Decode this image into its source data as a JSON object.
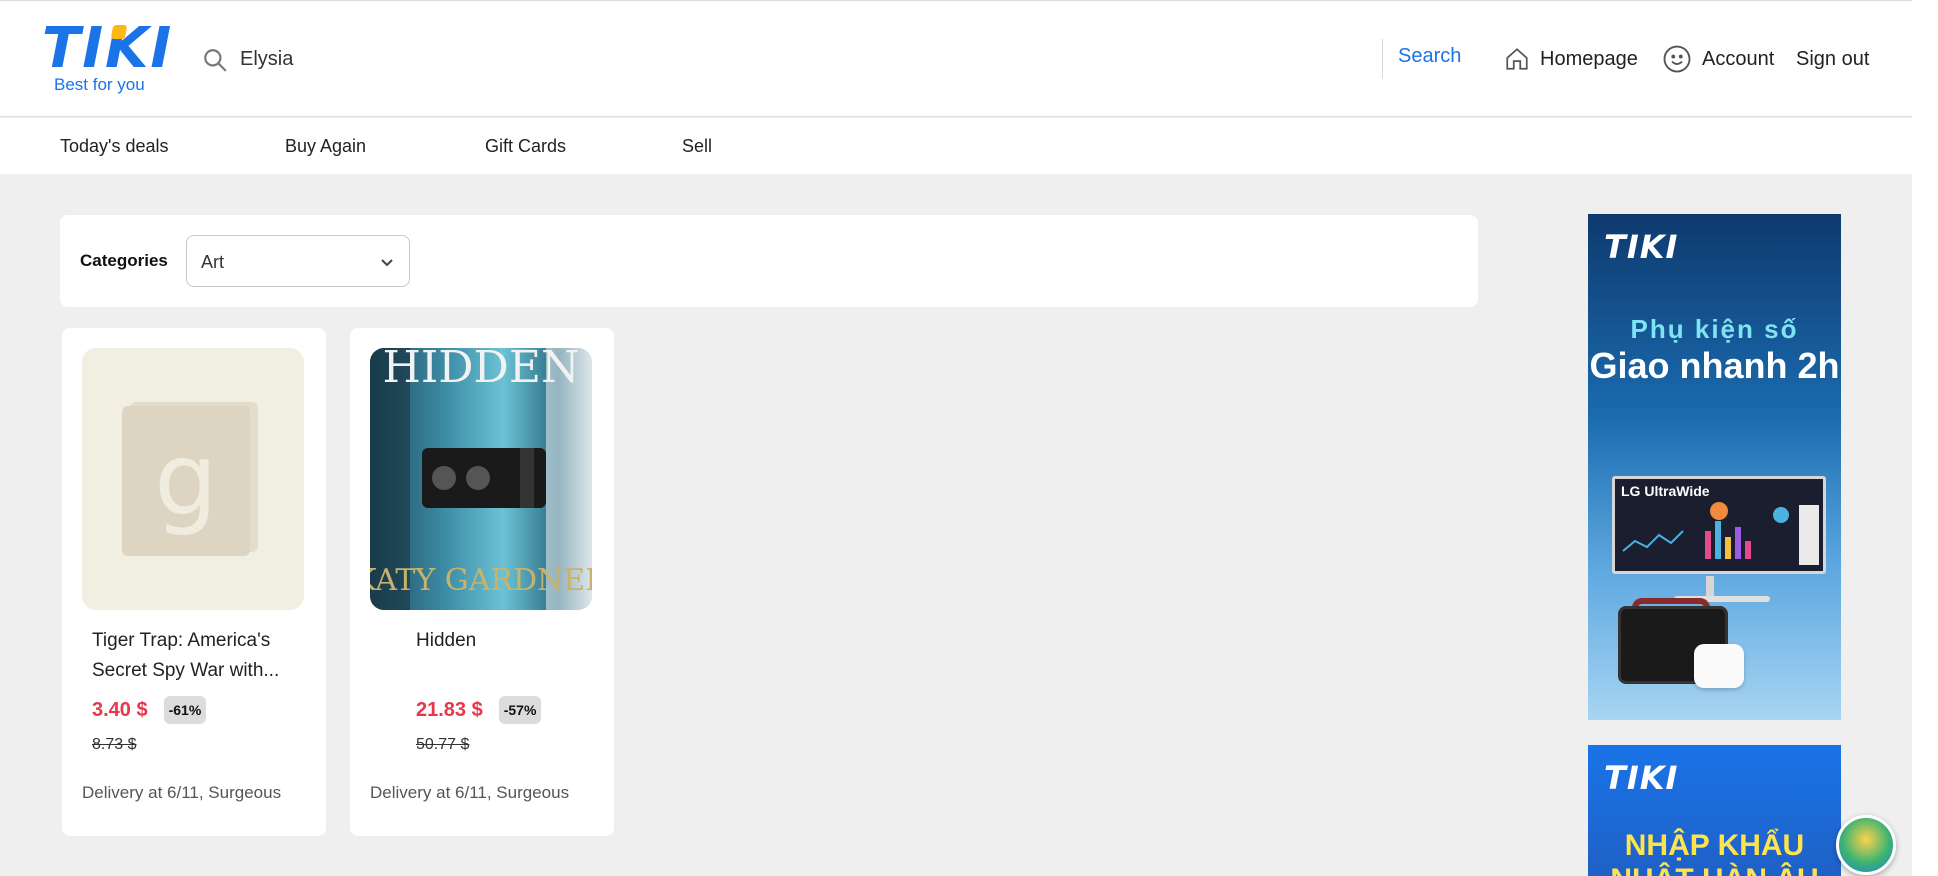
{
  "header": {
    "logo_text": "TIKI",
    "logo_tagline": "Best for you",
    "search_value": "Elysia",
    "search_button": "Search",
    "nav": {
      "home": "Homepage",
      "account": "Account",
      "signout": "Sign out"
    }
  },
  "subnav": [
    "Today's deals",
    "Buy Again",
    "Gift Cards",
    "Sell"
  ],
  "categories": {
    "label": "Categories",
    "selected": "Art"
  },
  "products": [
    {
      "title": "Tiger Trap: America's Secret Spy War with...",
      "price": "3.40 $",
      "discount": "-61%",
      "original_price": "8.73 $",
      "delivery": "Delivery at 6/11, Surgeous",
      "image": "goodreads-placeholder"
    },
    {
      "title": "Hidden",
      "price": "21.83 $",
      "discount": "-57%",
      "original_price": "50.77 $",
      "delivery": "Delivery at 6/11, Surgeous",
      "image": "book-cover-hidden",
      "cover_title": "HIDDEN",
      "cover_author": "KATY GARDNER"
    }
  ],
  "ads": [
    {
      "brand": "TIKI",
      "subtitle": "Phụ kiện số",
      "headline": "Giao nhanh 2h",
      "product_label": "LG UltraWide"
    },
    {
      "brand": "TIKI",
      "headline": "NHẬP KHẨU NHẬT HÀN ÂU"
    }
  ],
  "colors": {
    "brand_blue": "#1a74e8",
    "price_red": "#e8364a",
    "page_bg": "#efefef"
  }
}
